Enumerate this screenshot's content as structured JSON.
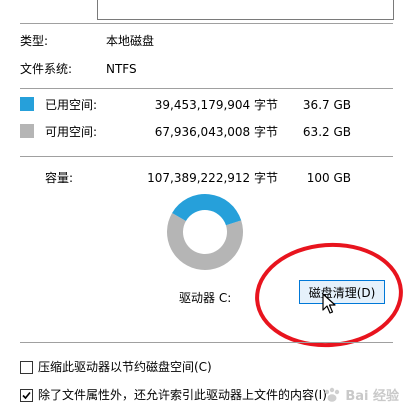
{
  "general": {
    "type_label": "类型:",
    "type_value": "本地磁盘",
    "fs_label": "文件系统:",
    "fs_value": "NTFS"
  },
  "space": {
    "used": {
      "label": "已用空间:",
      "bytes": "39,453,179,904 字节",
      "size": "36.7 GB",
      "color": "#26a0da"
    },
    "free": {
      "label": "可用空间:",
      "bytes": "67,936,043,008 字节",
      "size": "63.2 GB",
      "color": "#b5b5b5"
    },
    "capacity": {
      "label": "容量:",
      "bytes": "107,389,222,912 字节",
      "size": "100 GB"
    }
  },
  "chart_data": {
    "type": "pie",
    "categories": [
      "已用空间",
      "可用空间"
    ],
    "values": [
      39453179904,
      67936043008
    ],
    "colors": [
      "#26a0da",
      "#b5b5b5"
    ]
  },
  "drive": {
    "label": "驱动器 C:",
    "cleanup_button": "磁盘清理(D)"
  },
  "options": [
    {
      "label": "压缩此驱动器以节约磁盘空间(C)",
      "checked": false
    },
    {
      "label": "除了文件属性外，还允许索引此驱动器上文件的内容(I)",
      "checked": true
    }
  ],
  "watermark": "Bai 经验"
}
